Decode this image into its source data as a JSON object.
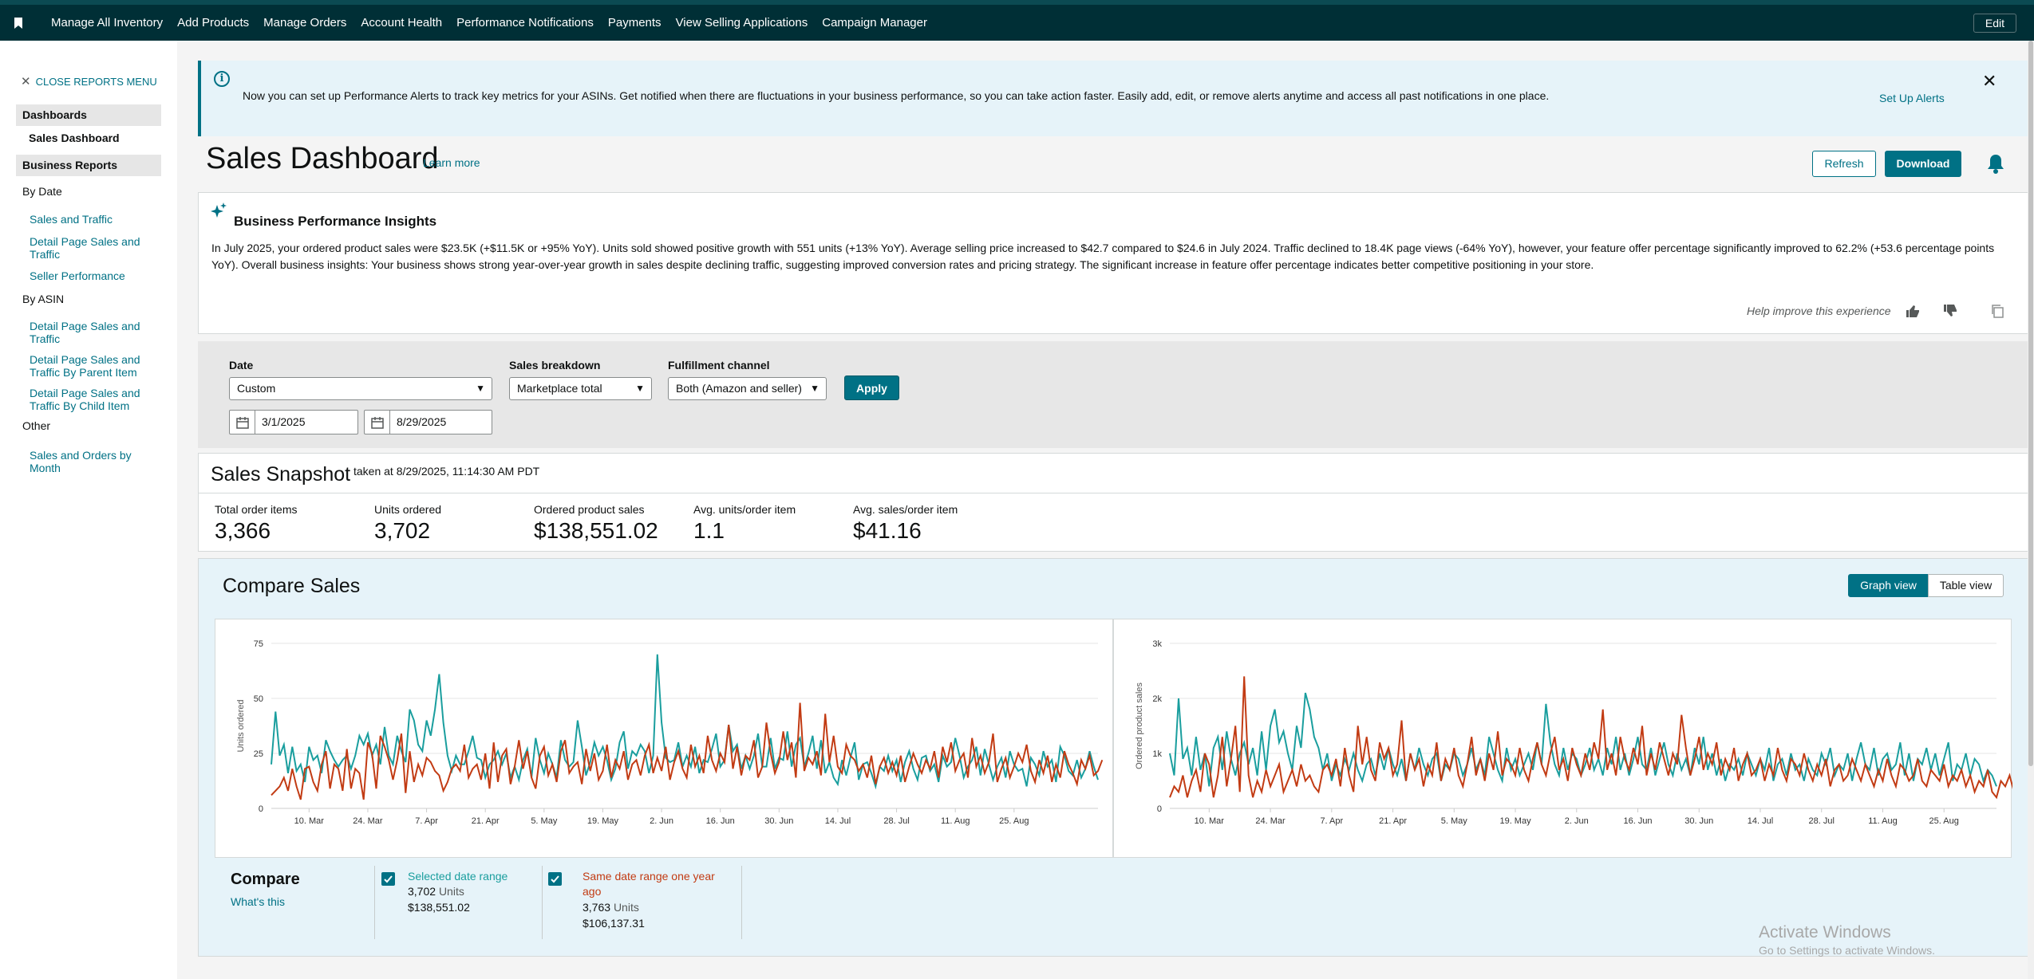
{
  "topnav": {
    "items": [
      "Manage All Inventory",
      "Add Products",
      "Manage Orders",
      "Account Health",
      "Performance Notifications",
      "Payments",
      "View Selling Applications",
      "Campaign Manager"
    ],
    "edit_label": "Edit"
  },
  "sidebar": {
    "close_label": "CLOSE REPORTS MENU",
    "dashboards_header": "Dashboards",
    "active_item": "Sales Dashboard",
    "business_reports_header": "Business Reports",
    "by_date_label": "By Date",
    "by_date_links": [
      "Sales and Traffic",
      "Detail Page Sales and Traffic",
      "Seller Performance"
    ],
    "by_asin_label": "By ASIN",
    "by_asin_links": [
      "Detail Page Sales and Traffic",
      "Detail Page Sales and Traffic By Parent Item",
      "Detail Page Sales and Traffic By Child Item"
    ],
    "other_label": "Other",
    "other_links": [
      "Sales and Orders by Month"
    ]
  },
  "alert": {
    "message": "Now you can set up Performance Alerts to track key metrics for your ASINs. Get notified when there are fluctuations in your business performance, so you can take action faster. Easily add, edit, or remove alerts anytime and access all past notifications in one place.",
    "action": "Set Up Alerts"
  },
  "header": {
    "title": "Sales Dashboard",
    "learn_more": "Learn more",
    "refresh": "Refresh",
    "download": "Download"
  },
  "insights": {
    "title": "Business Performance Insights",
    "body": "In July 2025, your ordered product sales were $23.5K (+$11.5K or +95% YoY). Units sold showed positive growth with 551 units (+13% YoY). Average selling price increased to $42.7 compared to $24.6 in July 2024. Traffic declined to 18.4K page views (-64% YoY), however, your feature offer percentage significantly improved to 62.2% (+53.6 percentage points YoY). Overall business insights: Your business shows strong year-over-year growth in sales despite declining traffic, suggesting improved conversion rates and pricing strategy. The significant increase in feature offer percentage indicates better competitive positioning in your store.",
    "help_text": "Help improve this experience"
  },
  "filters": {
    "date_label": "Date",
    "date_value": "Custom",
    "start_date": "3/1/2025",
    "end_date": "8/29/2025",
    "breakdown_label": "Sales breakdown",
    "breakdown_value": "Marketplace total",
    "fulfillment_label": "Fulfillment channel",
    "fulfillment_value": "Both (Amazon and seller)",
    "apply": "Apply"
  },
  "snapshot": {
    "title": "Sales Snapshot",
    "taken": "taken at 8/29/2025, 11:14:30 AM PDT",
    "metrics": [
      {
        "label": "Total order items",
        "value": "3,366"
      },
      {
        "label": "Units ordered",
        "value": "3,702"
      },
      {
        "label": "Ordered product sales",
        "value": "$138,551.02"
      },
      {
        "label": "Avg. units/order item",
        "value": "1.1"
      },
      {
        "label": "Avg. sales/order item",
        "value": "$41.16"
      }
    ]
  },
  "compare": {
    "title": "Compare Sales",
    "graph_view": "Graph view",
    "table_view": "Table view",
    "legend_title": "Compare",
    "whats_this": "What's this",
    "selected_label": "Selected date range",
    "selected_units": "3,702",
    "selected_sales": "$138,551.02",
    "prior_label": "Same date range one year ago",
    "prior_units": "3,763",
    "prior_sales": "$106,137.31",
    "units_word": "Units"
  },
  "colors": {
    "current": "#1a9e9e",
    "prior": "#c23b13",
    "accent": "#007185",
    "nav_bg": "#002f36"
  },
  "chart_data": [
    {
      "type": "line",
      "ylabel": "Units ordered",
      "ylim": [
        0,
        75
      ],
      "yticks": [
        0,
        25,
        50,
        75
      ],
      "x_tick_labels": [
        "10. Mar",
        "24. Mar",
        "7. Apr",
        "21. Apr",
        "5. May",
        "19. May",
        "2. Jun",
        "16. Jun",
        "30. Jun",
        "14. Jul",
        "28. Jul",
        "11. Aug",
        "25. Aug"
      ],
      "x_start": "2025-03-01",
      "series": [
        {
          "name": "Selected date range",
          "values": [
            20,
            44,
            24,
            29,
            16,
            28,
            17,
            20,
            12,
            28,
            22,
            24,
            16,
            31,
            26,
            22,
            19,
            22,
            24,
            18,
            24,
            33,
            29,
            34,
            24,
            29,
            20,
            37,
            24,
            20,
            33,
            26,
            21,
            45,
            40,
            29,
            26,
            40,
            33,
            45,
            61,
            39,
            24,
            17,
            24,
            20,
            20,
            26,
            33,
            23,
            22,
            14,
            20,
            22,
            26,
            20,
            25,
            14,
            19,
            13,
            22,
            27,
            14,
            32,
            22,
            16,
            25,
            20,
            14,
            31,
            22,
            19,
            21,
            40,
            28,
            15,
            21,
            30,
            24,
            28,
            22,
            13,
            18,
            30,
            35,
            18,
            26,
            24,
            29,
            26,
            16,
            24,
            70,
            39,
            23,
            21,
            22,
            30,
            19,
            24,
            19,
            28,
            16,
            22,
            21,
            27,
            34,
            19,
            22,
            38,
            26,
            29,
            18,
            24,
            18,
            24,
            34,
            19,
            19,
            32,
            18,
            23,
            22,
            35,
            19,
            29,
            32,
            19,
            25,
            33,
            18,
            31,
            16,
            21,
            14,
            11,
            22,
            15,
            23,
            30,
            13,
            20,
            21,
            16,
            10,
            19,
            17,
            24,
            17,
            22,
            12,
            21,
            26,
            18,
            13,
            23,
            24,
            17,
            20,
            12,
            24,
            19,
            21,
            32,
            24,
            14,
            19,
            22,
            28,
            15,
            27,
            20,
            13,
            19,
            23,
            14,
            26,
            20,
            17,
            18,
            10,
            23,
            20,
            15,
            26,
            19,
            22,
            12,
            28,
            24,
            17,
            15,
            22,
            14,
            18,
            26,
            19,
            13
          ]
        },
        {
          "name": "Same date range one year ago",
          "values": [
            6,
            8,
            10,
            14,
            8,
            18,
            10,
            4,
            18,
            19,
            12,
            8,
            20,
            26,
            9,
            20,
            18,
            8,
            27,
            9,
            18,
            16,
            4,
            30,
            25,
            9,
            33,
            28,
            22,
            13,
            22,
            34,
            7,
            26,
            12,
            20,
            15,
            23,
            21,
            17,
            15,
            8,
            12,
            18,
            20,
            17,
            29,
            14,
            18,
            20,
            13,
            25,
            9,
            30,
            12,
            24,
            27,
            11,
            19,
            31,
            18,
            26,
            14,
            9,
            24,
            28,
            15,
            20,
            12,
            26,
            31,
            16,
            19,
            21,
            11,
            27,
            17,
            25,
            13,
            17,
            29,
            14,
            22,
            18,
            26,
            13,
            20,
            22,
            15,
            24,
            29,
            16,
            23,
            17,
            28,
            13,
            21,
            26,
            18,
            14,
            29,
            19,
            24,
            16,
            33,
            22,
            17,
            25,
            21,
            38,
            18,
            28,
            15,
            24,
            22,
            31,
            14,
            19,
            39,
            25,
            16,
            21,
            35,
            22,
            30,
            14,
            48,
            17,
            23,
            20,
            26,
            15,
            43,
            21,
            33,
            19,
            16,
            29,
            24,
            22,
            17,
            20,
            14,
            24,
            11,
            19,
            23,
            16,
            21,
            15,
            24,
            12,
            19,
            25,
            20,
            16,
            22,
            18,
            26,
            14,
            28,
            21,
            30,
            17,
            22,
            25,
            14,
            32,
            19,
            24,
            16,
            21,
            34,
            12,
            18,
            23,
            14,
            19,
            25,
            21,
            29,
            17,
            12,
            22,
            16,
            24,
            12,
            20,
            14,
            26,
            20,
            16,
            11,
            22,
            18,
            24,
            15,
            17,
            22
          ]
        }
      ]
    },
    {
      "type": "line",
      "ylabel": "Ordered product sales",
      "ylim": [
        0,
        3000
      ],
      "yticks": [
        "0",
        "1k",
        "2k",
        "3k"
      ],
      "x_tick_labels": [
        "10. Mar",
        "24. Mar",
        "7. Apr",
        "21. Apr",
        "5. May",
        "19. May",
        "2. Jun",
        "16. Jun",
        "30. Jun",
        "14. Jul",
        "28. Jul",
        "11. Aug",
        "25. Aug"
      ],
      "x_start": "2025-03-01",
      "series": [
        {
          "name": "Selected date range",
          "values": [
            1000,
            600,
            2000,
            900,
            1100,
            600,
            1300,
            700,
            1000,
            400,
            1100,
            1300,
            700,
            1400,
            900,
            600,
            1000,
            1200,
            800,
            1100,
            600,
            1400,
            700,
            1500,
            1800,
            1200,
            1400,
            1000,
            700,
            1500,
            1100,
            2100,
            1800,
            1300,
            1100,
            700,
            1000,
            500,
            800,
            600,
            900,
            700,
            1000,
            700,
            500,
            800,
            900,
            600,
            1000,
            700,
            1100,
            800,
            600,
            900,
            500,
            1000,
            700,
            1100,
            800,
            600,
            900,
            1000,
            500,
            800,
            700,
            1000,
            900,
            600,
            800,
            1100,
            700,
            900,
            600,
            1300,
            1000,
            700,
            500,
            1100,
            700,
            900,
            600,
            800,
            1000,
            700,
            1200,
            800,
            1900,
            1200,
            800,
            600,
            1100,
            700,
            1000,
            900,
            600,
            800,
            1100,
            700,
            900,
            600,
            1100,
            800,
            1300,
            700,
            1000,
            600,
            900,
            1300,
            800,
            700,
            1100,
            600,
            900,
            1200,
            800,
            600,
            1000,
            700,
            900,
            600,
            1100,
            800,
            1300,
            700,
            1000,
            600,
            900,
            500,
            800,
            700,
            900,
            600,
            1000,
            800,
            600,
            900,
            700,
            1100,
            500,
            800,
            900,
            600,
            1000,
            700,
            800,
            500,
            900,
            700,
            600,
            1000,
            800,
            1100,
            600,
            800,
            700,
            1000,
            500,
            900,
            1200,
            800,
            700,
            1100,
            600,
            900,
            1000,
            700,
            800,
            1200,
            600,
            1000,
            500,
            900,
            800,
            1100,
            700,
            1000,
            600,
            900,
            1200,
            500,
            800,
            700,
            1000,
            600,
            900,
            800,
            500,
            700,
            600,
            400
          ]
        },
        {
          "name": "Same date range one year ago",
          "values": [
            200,
            400,
            300,
            600,
            200,
            500,
            700,
            300,
            1000,
            800,
            200,
            600,
            1300,
            400,
            900,
            1500,
            300,
            2400,
            600,
            200,
            500,
            300,
            700,
            400,
            600,
            800,
            300,
            500,
            700,
            400,
            800,
            500,
            600,
            400,
            300,
            700,
            800,
            600,
            900,
            400,
            1100,
            600,
            300,
            1500,
            800,
            1300,
            700,
            500,
            1200,
            900,
            1100,
            600,
            800,
            1600,
            500,
            1000,
            700,
            900,
            400,
            800,
            600,
            1200,
            500,
            900,
            700,
            1100,
            600,
            400,
            800,
            1300,
            600,
            900,
            500,
            1000,
            700,
            1400,
            600,
            900,
            800,
            600,
            1100,
            700,
            500,
            900,
            1200,
            800,
            600,
            1000,
            1300,
            700,
            900,
            500,
            1100,
            800,
            600,
            1000,
            700,
            1200,
            900,
            1800,
            700,
            1000,
            600,
            1300,
            900,
            700,
            1100,
            800,
            1500,
            600,
            1000,
            700,
            1200,
            900,
            600,
            1000,
            800,
            1700,
            1100,
            600,
            900,
            1300,
            700,
            1000,
            800,
            1200,
            600,
            900,
            700,
            1100,
            500,
            800,
            1000,
            600,
            700,
            900,
            500,
            800,
            600,
            1100,
            700,
            500,
            900,
            800,
            600,
            1000,
            700,
            500,
            800,
            600,
            900,
            400,
            700,
            800,
            500,
            600,
            900,
            700,
            500,
            800,
            600,
            400,
            700,
            500,
            900,
            600,
            400,
            800,
            700,
            500,
            600,
            900,
            500,
            400,
            700,
            600,
            500,
            800,
            400,
            600,
            500,
            700,
            400,
            600,
            300,
            500,
            400,
            700,
            300,
            200,
            500,
            400,
            600,
            300,
            400,
            200
          ]
        }
      ]
    }
  ]
}
